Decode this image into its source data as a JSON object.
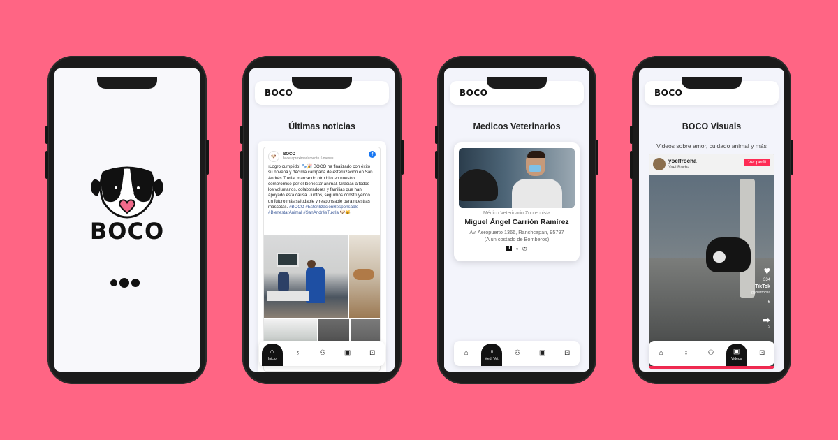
{
  "colors": {
    "background": "#ff6584",
    "accent": "#fe2c55",
    "dark": "#121212"
  },
  "splash": {
    "brand": "BOCO"
  },
  "app": {
    "brand": "BOCO"
  },
  "news": {
    "title": "Últimas noticias",
    "post": {
      "author": "BOCO",
      "time": "hace aproximadamente 5 meses",
      "body": "¡Logro cumplido! 🐾🎉 BOCO ha finalizado con éxito su novena y décima campaña de esterilización en San Andrés Tuxtla, marcando otro hito en nuestro compromiso por el bienestar animal. Gracias a todos los voluntarios, colaboradores y familias que han apoyado esta causa. Juntos, seguimos construyendo un futuro más saludable y responsable para nuestras mascotas.",
      "hashtags": "#BOCO #EsterilizaciónResponsable #BienestarAnimal #SanAndrésTuxtla 🐶😺"
    }
  },
  "vets": {
    "title": "Medicos Veterinarios",
    "card": {
      "role": "Médico Veterinario Zootecnista",
      "name": "Miguel Ángel Carrión Ramírez",
      "address_line1": "Av. Aeropuerto 1366, Ranchcapan, 95797",
      "address_line2": "(A un costado de Bomberos)",
      "icons": [
        "facebook-icon",
        "location-icon",
        "phone-icon"
      ]
    }
  },
  "visuals": {
    "title": "BOCO Visuals",
    "subtitle": "Videos sobre amor, cuidado animal y más",
    "video": {
      "username": "yoelfrocha",
      "realname": "Yoel Rocha",
      "follow_label": "Ver perfil",
      "likes": "334",
      "watermark": "TikTok",
      "handle": "@yoelfrocha",
      "comments": "6",
      "shares": "2"
    }
  },
  "nav": {
    "inicio": "Inicio",
    "medvet": "Med. Vet.",
    "videos": "Videos"
  }
}
